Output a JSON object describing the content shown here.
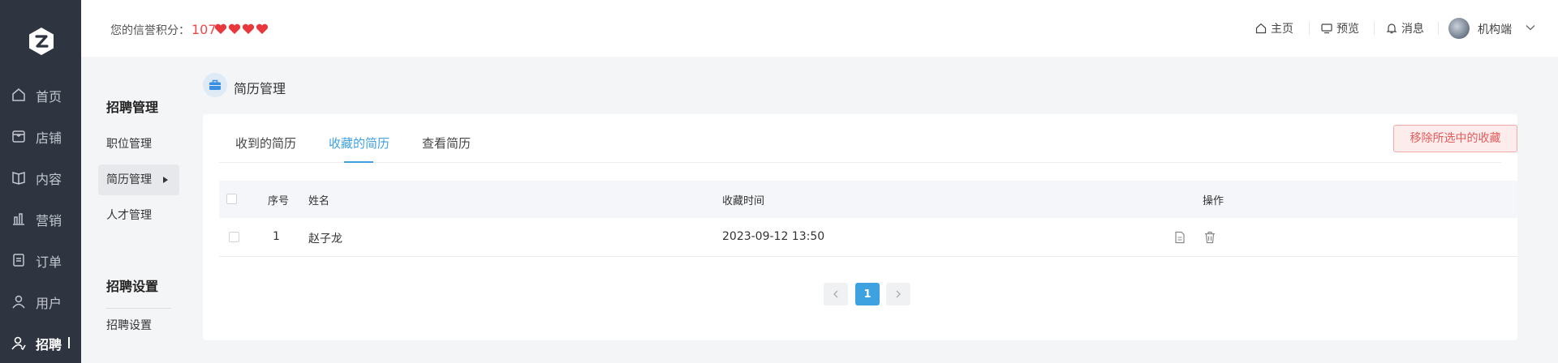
{
  "nav": {
    "items": [
      {
        "label": "首页",
        "icon": "home-icon"
      },
      {
        "label": "店铺",
        "icon": "store-icon"
      },
      {
        "label": "内容",
        "icon": "book-icon"
      },
      {
        "label": "营销",
        "icon": "bar-chart-icon"
      },
      {
        "label": "订单",
        "icon": "order-icon"
      },
      {
        "label": "用户",
        "icon": "user-icon"
      },
      {
        "label": "招聘",
        "icon": "recruit-icon"
      }
    ],
    "active_index": 6
  },
  "header": {
    "credit_label": "您的信誉积分：",
    "credit_score": "107",
    "hearts": 4,
    "links": {
      "home": "主页",
      "preview": "预览",
      "messages": "消息"
    },
    "org_label": "机构端"
  },
  "subnav": {
    "group1_title": "招聘管理",
    "group1_items": [
      "职位管理",
      "简历管理",
      "人才管理"
    ],
    "active_item": "简历管理",
    "group2_title": "招聘设置",
    "group2_items": [
      "招聘设置"
    ]
  },
  "page": {
    "title": "简历管理"
  },
  "tabs": [
    {
      "label": "收到的简历",
      "active": false
    },
    {
      "label": "收藏的简历",
      "active": true
    },
    {
      "label": "查看简历",
      "active": false
    }
  ],
  "remove_button": "移除所选中的收藏",
  "table": {
    "columns": {
      "index": "序号",
      "name": "姓名",
      "time": "收藏时间",
      "actions": "操作"
    },
    "rows": [
      {
        "index": "1",
        "name": "赵子龙",
        "time": "2023-09-12 13:50"
      }
    ]
  },
  "pagination": {
    "current_page": "1"
  },
  "colors": {
    "accent": "#3ea2e0",
    "danger": "#e55b5b",
    "nav_bg": "#2e3440",
    "heart": "#e8383d"
  }
}
